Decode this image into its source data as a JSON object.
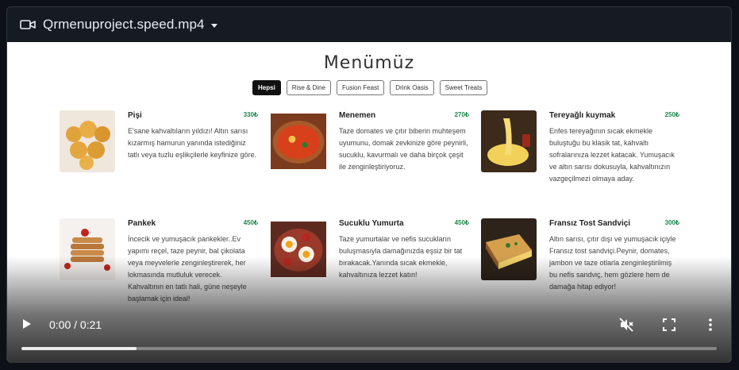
{
  "header": {
    "title": "Qrmenuproject.speed.mp4"
  },
  "video": {
    "menu_title": "Menümüz",
    "tabs": [
      {
        "label": "Hepsi",
        "active": true
      },
      {
        "label": "Rise & Dine",
        "active": false
      },
      {
        "label": "Fusion Feast",
        "active": false
      },
      {
        "label": "Drink Oasis",
        "active": false
      },
      {
        "label": "Sweet Treats",
        "active": false
      }
    ],
    "items": [
      {
        "name": "Pişi",
        "price": "330₺",
        "desc": "E'sane kahvaltıların yıldızı! Altın sarısı kızarmış hamurun yanında istediğiniz tatlı veya tuzlu eşlikçilerle keyfinize göre."
      },
      {
        "name": "Menemen",
        "price": "270₺",
        "desc": "Taze domates ve çıtır biberin muhteşem uyumunu, domak zevkinize göre peynirli, sucuklu, kavurmalı ve daha birçok çeşit ile zenginleştiriyoruz."
      },
      {
        "name": "Tereyağlı kuymak",
        "price": "250₺",
        "desc": "Enfes tereyağının sıcak ekmekle buluştuğu bu klasik tat, kahvaltı sofralarınıza lezzet katacak. Yumuşacık ve altın sarısı dokusuyla, kahvaltınızın vazgeçilmezi olmaya aday."
      },
      {
        "name": "Pankek",
        "price": "450₺",
        "desc": "İncecik ve yumuşacık pankekler..Ev yapımı reçel, taze peynir, bal çikolata veya meyvelerle zenginleştirerek, her lokmasında mutluluk verecek. Kahvaltının en tatlı hali, güne neşeyle başlamak için ideal!"
      },
      {
        "name": "Sucuklu Yumurta",
        "price": "450₺",
        "desc": "Taze yumurtalar ve nefis sucukların buluşmasıyla damağınızda eşsiz bir tat bırakacak.Yanında sıcak ekmekle, kahvaltınıza lezzet katın!"
      },
      {
        "name": "Fransız Tost Sandviçi",
        "price": "300₺",
        "desc": "Altın sarısı, çıtır dışı ve yumuşacık içiyle Fransız tost sandviçi.Peynir, domates, jambon ve taze otlarla zenginleştirilmiş bu nefis sandviç, hem gözlere hem de damağa hitap ediyor!"
      }
    ]
  },
  "controls": {
    "time": "0:00 / 0:21",
    "progress": 0.166,
    "icons": [
      "play-icon",
      "mute-icon",
      "fullscreen-icon",
      "more-icon"
    ]
  },
  "colors": {
    "accent_price": "#1f8a4c",
    "header_bg": "#161b22",
    "header_text": "#e6edf3"
  }
}
